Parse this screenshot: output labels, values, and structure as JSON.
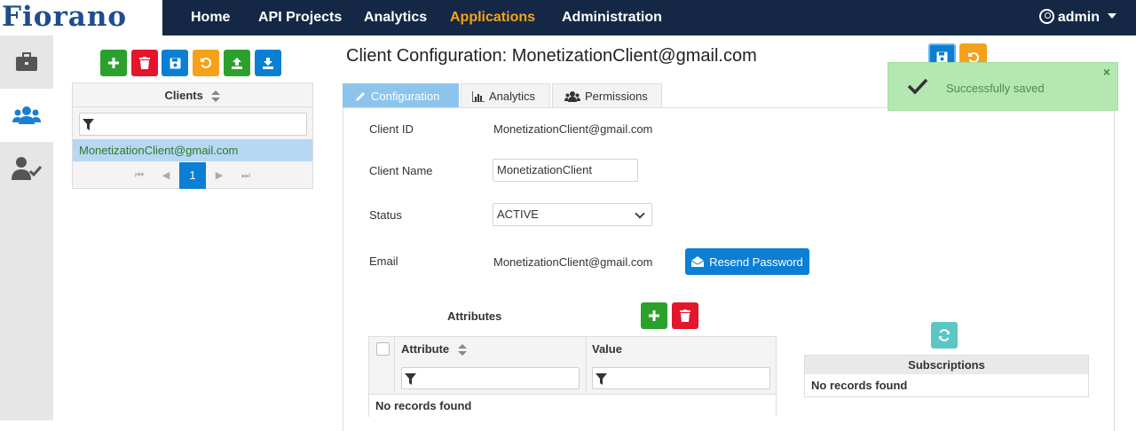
{
  "brand": {
    "logo_text": "Fiorano"
  },
  "nav": {
    "items": [
      {
        "label": "Home"
      },
      {
        "label": "API Projects"
      },
      {
        "label": "Analytics"
      },
      {
        "label": "Applications",
        "active": true
      },
      {
        "label": "Administration"
      }
    ],
    "user": "admin"
  },
  "rail": {
    "items": [
      "briefcase-icon",
      "users-icon",
      "user-check-icon"
    ],
    "active": "users-icon"
  },
  "clients_panel": {
    "toolbar": [
      "add",
      "delete",
      "save",
      "revert",
      "export",
      "import"
    ],
    "header": "Clients",
    "selected": "MonetizationClient@gmail.com",
    "pager": {
      "current": "1"
    }
  },
  "main": {
    "title": "Client Configuration: MonetizationClient@gmail.com",
    "tabs": [
      {
        "label": "Configuration",
        "active": true
      },
      {
        "label": "Analytics"
      },
      {
        "label": "Permissions"
      }
    ],
    "form": {
      "client_id_label": "Client ID",
      "client_id_value": "MonetizationClient@gmail.com",
      "client_name_label": "Client Name",
      "client_name_value": "MonetizationClient",
      "status_label": "Status",
      "status_value": "ACTIVE",
      "email_label": "Email",
      "email_value": "MonetizationClient@gmail.com",
      "resend_label": "Resend Password"
    },
    "attributes": {
      "title": "Attributes",
      "col_attribute": "Attribute",
      "col_value": "Value",
      "empty": "No records found"
    },
    "subscriptions": {
      "title": "Subscriptions",
      "empty": "No records found"
    }
  },
  "toast": {
    "message": "Successfully saved",
    "close": "×"
  },
  "colors": {
    "navbar": "#142846",
    "active_nav": "#f7a21b",
    "green": "#2ca02c",
    "red": "#e3162b",
    "blue": "#0a7fd4",
    "orange": "#f5a11a",
    "teal": "#5bc7c4"
  }
}
